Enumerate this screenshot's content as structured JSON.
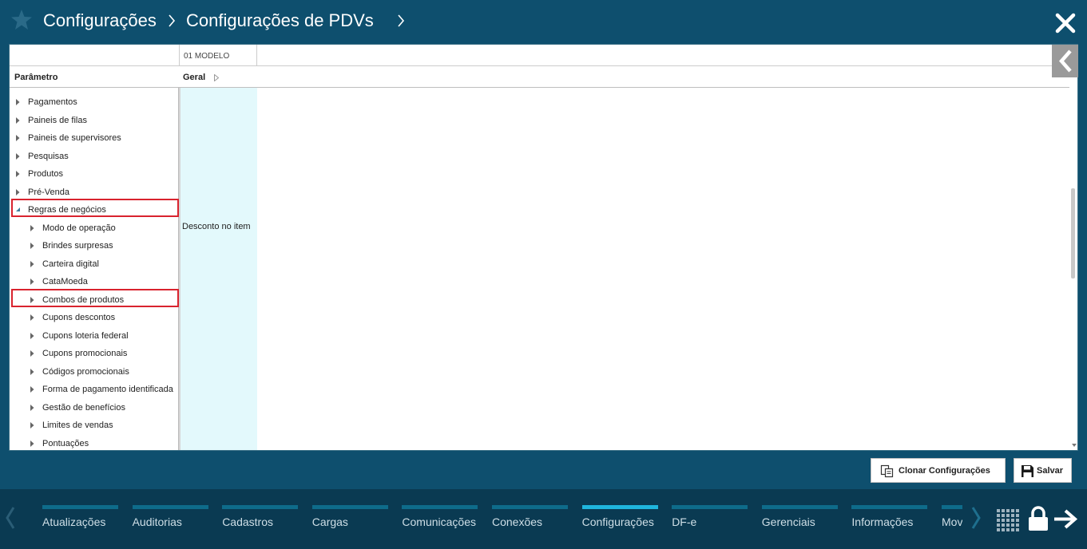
{
  "breadcrumb": {
    "items": [
      "Configurações",
      "Configurações de PDVs"
    ],
    "icons": [
      "star-icon",
      "chevron-right-icon",
      "close-icon"
    ]
  },
  "grid": {
    "model_column": "01 MODELO",
    "param_header": "Parâmetro",
    "group_header": "Geral",
    "cell_value": "Desconto no item"
  },
  "tree": {
    "items": [
      {
        "label": "Pagamentos",
        "level": 1,
        "expanded": false
      },
      {
        "label": "Paineis de filas",
        "level": 1,
        "expanded": false
      },
      {
        "label": "Paineis de supervisores",
        "level": 1,
        "expanded": false
      },
      {
        "label": "Pesquisas",
        "level": 1,
        "expanded": false
      },
      {
        "label": "Produtos",
        "level": 1,
        "expanded": false
      },
      {
        "label": "Pré-Venda",
        "level": 1,
        "expanded": false
      },
      {
        "label": "Regras de negócios",
        "level": 1,
        "expanded": true,
        "highlighted": true
      },
      {
        "label": "Modo de operação",
        "level": 2,
        "expanded": false
      },
      {
        "label": "Brindes surpresas",
        "level": 2,
        "expanded": false
      },
      {
        "label": "Carteira digital",
        "level": 2,
        "expanded": false
      },
      {
        "label": "CataMoeda",
        "level": 2,
        "expanded": false
      },
      {
        "label": "Combos de produtos",
        "level": 2,
        "expanded": false,
        "highlighted": true
      },
      {
        "label": "Cupons descontos",
        "level": 2,
        "expanded": false
      },
      {
        "label": "Cupons loteria federal",
        "level": 2,
        "expanded": false
      },
      {
        "label": "Cupons promocionais",
        "level": 2,
        "expanded": false
      },
      {
        "label": "Códigos promocionais",
        "level": 2,
        "expanded": false
      },
      {
        "label": "Forma de pagamento identificada",
        "level": 2,
        "expanded": false
      },
      {
        "label": "Gestão de benefícios",
        "level": 2,
        "expanded": false
      },
      {
        "label": "Limites de vendas",
        "level": 2,
        "expanded": false
      },
      {
        "label": "Pontuações",
        "level": 2,
        "expanded": false
      }
    ]
  },
  "actions": {
    "clone_label": "Clonar Configurações",
    "save_label": "Salvar"
  },
  "nav": {
    "items": [
      {
        "label": "Atualizações",
        "active": false
      },
      {
        "label": "Auditorias",
        "active": false
      },
      {
        "label": "Cadastros",
        "active": false
      },
      {
        "label": "Cargas",
        "active": false
      },
      {
        "label": "Comunicações",
        "active": false
      },
      {
        "label": "Conexões",
        "active": false
      },
      {
        "label": "Configurações",
        "active": true
      },
      {
        "label": "DF-e",
        "active": false
      },
      {
        "label": "Gerenciais",
        "active": false
      },
      {
        "label": "Informações",
        "active": false
      },
      {
        "label": "Mov",
        "active": false
      }
    ]
  },
  "colors": {
    "header_bg": "#0e4f6e",
    "nav_bg": "#0a3a52",
    "nav_active": "#1fb5dd",
    "highlight": "#d9232e",
    "cell_bg": "#e3f9fc"
  }
}
